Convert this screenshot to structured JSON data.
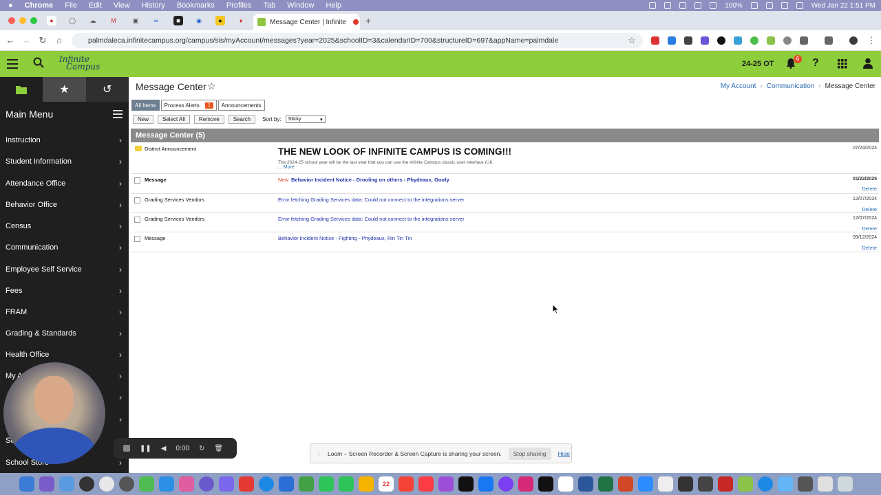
{
  "menubar": {
    "app": "Chrome",
    "items": [
      "File",
      "Edit",
      "View",
      "History",
      "Bookmarks",
      "Profiles",
      "Tab",
      "Window",
      "Help"
    ],
    "battery": "100%",
    "datetime": "Wed Jan 22  1:51 PM"
  },
  "browser": {
    "active_tab_title": "Message Center | Infinite",
    "url": "palmdaleca.infinitecampus.org/campus/sis/myAccount/messages?year=2025&schoolID=3&calendarID=700&structureID=697&appName=palmdale"
  },
  "header": {
    "logo_line1": "Infinite",
    "logo_line2": "Campus",
    "year": "24-25 OT",
    "notification_count": "6"
  },
  "sidebar": {
    "title": "Main Menu",
    "items": [
      {
        "label": "Instruction"
      },
      {
        "label": "Student Information"
      },
      {
        "label": "Attendance Office"
      },
      {
        "label": "Behavior Office"
      },
      {
        "label": "Census"
      },
      {
        "label": "Communication"
      },
      {
        "label": "Employee Self Service"
      },
      {
        "label": "Fees"
      },
      {
        "label": "FRAM"
      },
      {
        "label": "Grading & Standards"
      },
      {
        "label": "Health Office"
      },
      {
        "label": "My A"
      },
      {
        "label": ""
      },
      {
        "label": ""
      },
      {
        "label": "Sc"
      },
      {
        "label": "School Store"
      }
    ]
  },
  "page": {
    "title": "Message Center",
    "breadcrumb": [
      "My Account",
      "Communication",
      "Message Center"
    ]
  },
  "filters": {
    "all": "All Items",
    "process_alerts": "Process Alerts",
    "process_alerts_count": "1",
    "announcements": "Announcements"
  },
  "actions": {
    "new": "New",
    "select_all": "Select All",
    "remove": "Remove",
    "search": "Search",
    "sort_label": "Sort by:",
    "sort_value": "Sticky"
  },
  "message_center": {
    "header": "Message Center (5)",
    "announcement": {
      "type": "District Announcement",
      "headline": "THE NEW LOOK OF INFINITE CAMPUS IS COMING!!!",
      "snippet": "The 2024-25 school year will be the last year that you can use the Infinite Campus classic user interface (UI).",
      "more": "... More",
      "date": "07/24/2024"
    },
    "rows": [
      {
        "type": "Message",
        "new_tag": "New",
        "message": "Behavior Incident Notice - Drooling on others - Phydeaux, Goofy",
        "date": "01/22/2025",
        "delete": "Delete"
      },
      {
        "type": "Grading Services Vendors",
        "new_tag": "",
        "message": "Error fetching Grading Services data: Could not connect to the integrations server",
        "date": "12/07/2024",
        "delete": "Delete"
      },
      {
        "type": "Grading Services Vendors",
        "new_tag": "",
        "message": "Error fetching Grading Services data: Could not connect to the integrations server",
        "date": "12/07/2024",
        "delete": "Delete"
      },
      {
        "type": "Message",
        "new_tag": "",
        "message": "Behavior Incident Notice - Fighting - Phydeaux, Rin Tin Tin",
        "date": "09/12/2024",
        "delete": "Delete"
      }
    ]
  },
  "loom": {
    "timer": "0:00",
    "share_text": "Loom – Screen Recorder & Screen Capture is sharing your screen.",
    "stop_sharing": "Stop sharing",
    "hide": "Hide"
  },
  "dock_date": "22",
  "colors": {
    "ic_green": "#8ecd3c",
    "sidebar_bg": "#1f1f1f",
    "link_blue": "#2a6bb5",
    "message_blue": "#2233aa",
    "badge_orange": "#e8571f"
  }
}
